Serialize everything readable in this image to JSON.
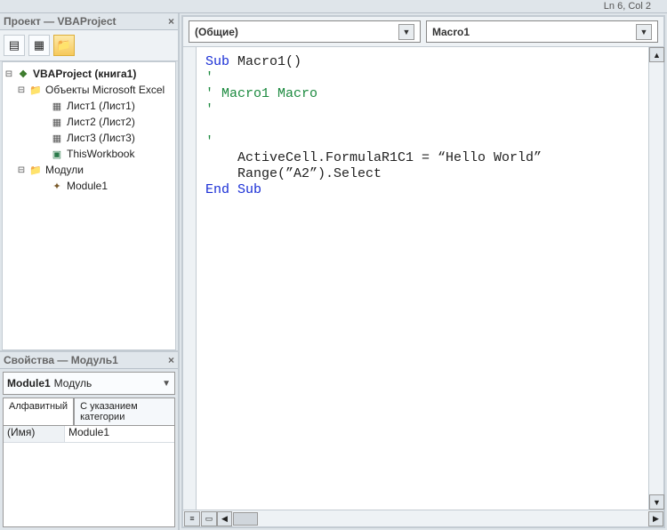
{
  "statusbar": {
    "pos": "Ln 6, Col 2"
  },
  "project_pane": {
    "title": "Проект — VBAProject",
    "root": "VBAProject (книга1)",
    "objects_folder": "Объекты Microsoft Excel",
    "sheets": [
      "Лист1 (Лист1)",
      "Лист2 (Лист2)",
      "Лист3 (Лист3)"
    ],
    "workbook": "ThisWorkbook",
    "modules_folder": "Модули",
    "module": "Module1"
  },
  "properties_pane": {
    "title": "Свойства — Модуль1",
    "object_name": "Module1",
    "object_type": "Модуль",
    "tabs": {
      "alpha": "Алфавитный",
      "cat": "С указанием категории"
    },
    "rows": {
      "name_key": "(Имя)",
      "name_val": "Module1"
    }
  },
  "code_pane": {
    "object_dd": "(Общие)",
    "proc_dd": "Macro1",
    "lines": {
      "l1a": "Sub",
      "l1b": " Macro1()",
      "l2": "'",
      "l3": "' Macro1 Macro",
      "l4": "'",
      "l5": " ",
      "l6": "'",
      "l7": "    ActiveCell.FormulaR1C1 = “Hello World”",
      "l8": "    Range(”A2”).Select",
      "l9a": "End",
      "l9b": " ",
      "l9c": "Sub"
    }
  }
}
